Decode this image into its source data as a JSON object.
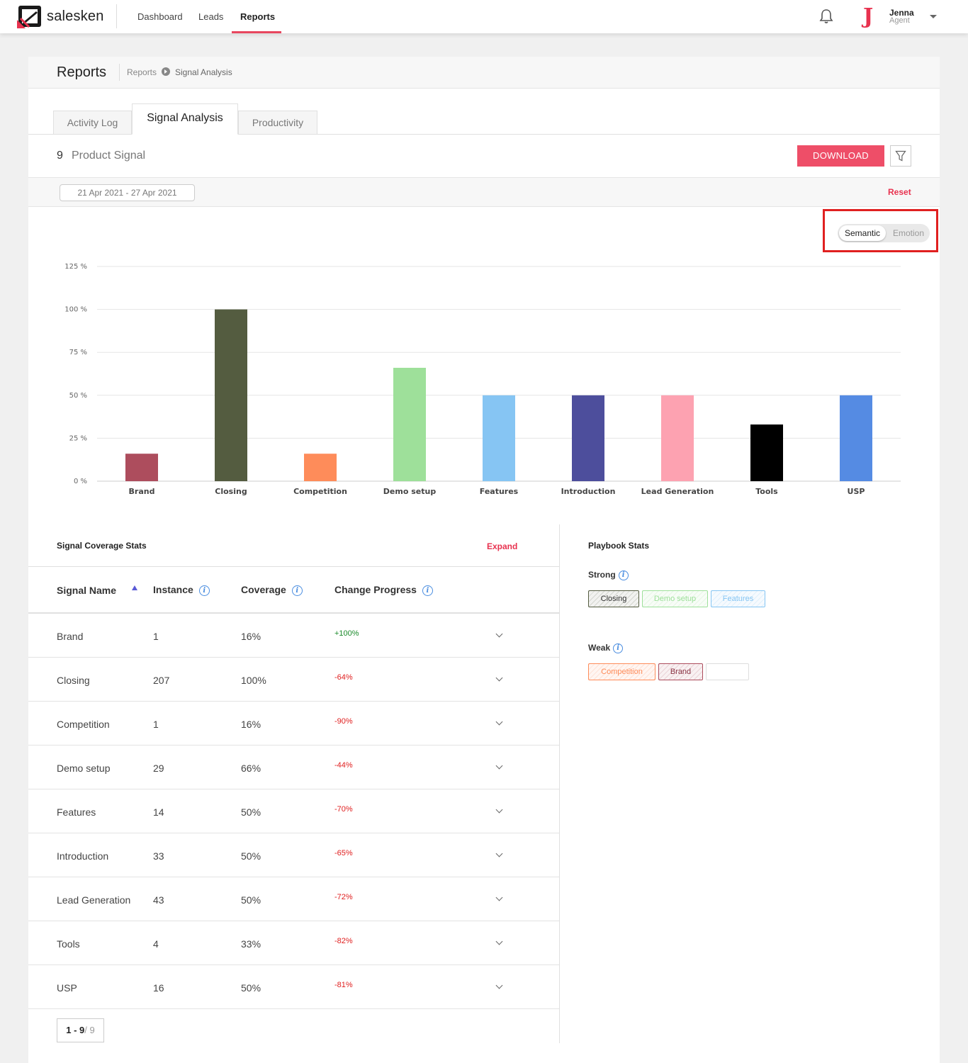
{
  "app": {
    "logo_text": "salesken",
    "nav": [
      "Dashboard",
      "Leads",
      "Reports"
    ],
    "active_nav": "Reports",
    "user": {
      "initial": "J",
      "name": "Jenna",
      "role": "Agent"
    }
  },
  "page": {
    "title": "Reports",
    "breadcrumb": [
      "Reports",
      "Signal Analysis"
    ],
    "tabs": [
      "Activity Log",
      "Signal Analysis",
      "Productivity"
    ],
    "active_tab": "Signal Analysis",
    "signal_count": "9",
    "signal_label": "Product Signal",
    "download_label": "DOWNLOAD",
    "date_range": "21 Apr 2021 - 27 Apr 2021",
    "reset_label": "Reset",
    "toggle": {
      "on": "Semantic",
      "off": "Emotion"
    }
  },
  "chart_data": {
    "type": "bar",
    "categories": [
      "Brand",
      "Closing",
      "Competition",
      "Demo setup",
      "Features",
      "Introduction",
      "Lead Generation",
      "Tools",
      "USP"
    ],
    "values": [
      16,
      100,
      16,
      66,
      50,
      50,
      50,
      33,
      50
    ],
    "colors": [
      "#ad4d5d",
      "#545c40",
      "#fe8c5a",
      "#9ee09a",
      "#86c5f3",
      "#4d4e9c",
      "#fda2b1",
      "#000000",
      "#558be3"
    ],
    "yticks": [
      "0 %",
      "25 %",
      "50 %",
      "75 %",
      "100 %",
      "125 %"
    ],
    "ylim": [
      0,
      125
    ],
    "grid": true
  },
  "coverage": {
    "title": "Signal Coverage Stats",
    "expand_label": "Expand",
    "columns": [
      "Signal Name",
      "Instance",
      "Coverage",
      "Change Progress"
    ],
    "rows": [
      {
        "name": "Brand",
        "instance": "1",
        "coverage": "16%",
        "change": "+100%"
      },
      {
        "name": "Closing",
        "instance": "207",
        "coverage": "100%",
        "change": "-64%"
      },
      {
        "name": "Competition",
        "instance": "1",
        "coverage": "16%",
        "change": "-90%"
      },
      {
        "name": "Demo setup",
        "instance": "29",
        "coverage": "66%",
        "change": "-44%"
      },
      {
        "name": "Features",
        "instance": "14",
        "coverage": "50%",
        "change": "-70%"
      },
      {
        "name": "Introduction",
        "instance": "33",
        "coverage": "50%",
        "change": "-65%"
      },
      {
        "name": "Lead Generation",
        "instance": "43",
        "coverage": "50%",
        "change": "-72%"
      },
      {
        "name": "Tools",
        "instance": "4",
        "coverage": "33%",
        "change": "-82%"
      },
      {
        "name": "USP",
        "instance": "16",
        "coverage": "50%",
        "change": "-81%"
      }
    ],
    "pager": {
      "range": "1 - 9",
      "total": "/ 9"
    }
  },
  "playbook": {
    "title": "Playbook Stats",
    "strong_label": "Strong",
    "weak_label": "Weak",
    "strong": [
      {
        "label": "Closing",
        "color": "#545c40",
        "text_color": "#333333"
      },
      {
        "label": "Demo setup",
        "color": "#9ee09a",
        "text_color": "#9ee09a"
      },
      {
        "label": "Features",
        "color": "#86c5f3",
        "text_color": "#86c5f3"
      }
    ],
    "weak": [
      {
        "label": "Competition",
        "color": "#fe8c5a",
        "text_color": "#fe8c5a"
      },
      {
        "label": "Brand",
        "color": "#ad4d5d",
        "text_color": "#8a3344"
      },
      {
        "label": "",
        "color": "#dddddd",
        "text_color": "#999999"
      }
    ]
  }
}
